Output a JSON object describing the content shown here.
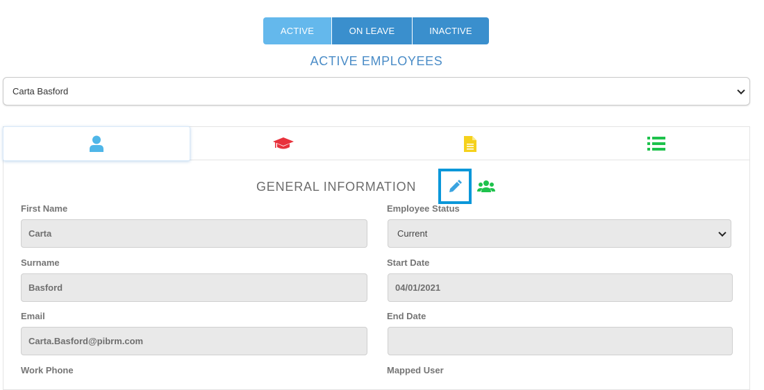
{
  "status_tabs": {
    "active": "ACTIVE",
    "on_leave": "ON LEAVE",
    "inactive": "INACTIVE"
  },
  "heading": "ACTIVE EMPLOYEES",
  "employee_select": {
    "selected": "Carta Basford"
  },
  "section_tabs": [
    {
      "icon": "user-icon",
      "color": "#4fb6e8"
    },
    {
      "icon": "graduation-cap-icon",
      "color": "#e8323c"
    },
    {
      "icon": "document-icon",
      "color": "#f5d11c"
    },
    {
      "icon": "list-icon",
      "color": "#1ec24c"
    }
  ],
  "general_information": {
    "title": "GENERAL INFORMATION",
    "edit_icon_color": "#3aa3e0",
    "group_icon_color": "#1ec24c"
  },
  "fields": {
    "first_name": {
      "label": "First Name",
      "value": "Carta"
    },
    "surname": {
      "label": "Surname",
      "value": "Basford"
    },
    "email": {
      "label": "Email",
      "value": "Carta.Basford@pibrm.com"
    },
    "work_phone": {
      "label": "Work Phone"
    },
    "employee_status": {
      "label": "Employee Status",
      "value": "Current"
    },
    "start_date": {
      "label": "Start Date",
      "value": "04/01/2021"
    },
    "end_date": {
      "label": "End Date",
      "value": ""
    },
    "mapped_user": {
      "label": "Mapped User"
    }
  }
}
